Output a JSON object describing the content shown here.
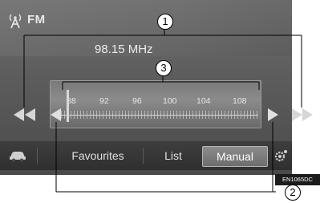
{
  "header": {
    "band_label": "FM",
    "band_icon": "antenna-icon"
  },
  "station": {
    "frequency": "98.15 MHz"
  },
  "tuner": {
    "scale_labels": [
      "88",
      "92",
      "96",
      "100",
      "104",
      "108"
    ]
  },
  "controls": {
    "seek_back_icon": "double-arrow-left-icon",
    "step_back_icon": "arrow-left-icon",
    "step_forward_icon": "arrow-right-icon",
    "seek_forward_icon": "double-arrow-right-icon"
  },
  "bottom_bar": {
    "source_icon": "car-icon",
    "tabs": [
      {
        "label": "Favourites"
      },
      {
        "label": "List"
      },
      {
        "label": "Manual",
        "selected": true
      }
    ],
    "settings_icon": "settings-icon"
  },
  "image_code": "EN1065DC",
  "callouts": [
    "1",
    "2",
    "3"
  ],
  "colors": {
    "screen_bg": "#5c5c5c",
    "tab_selected": "#7d7d7d",
    "text": "#e8e8e8"
  }
}
